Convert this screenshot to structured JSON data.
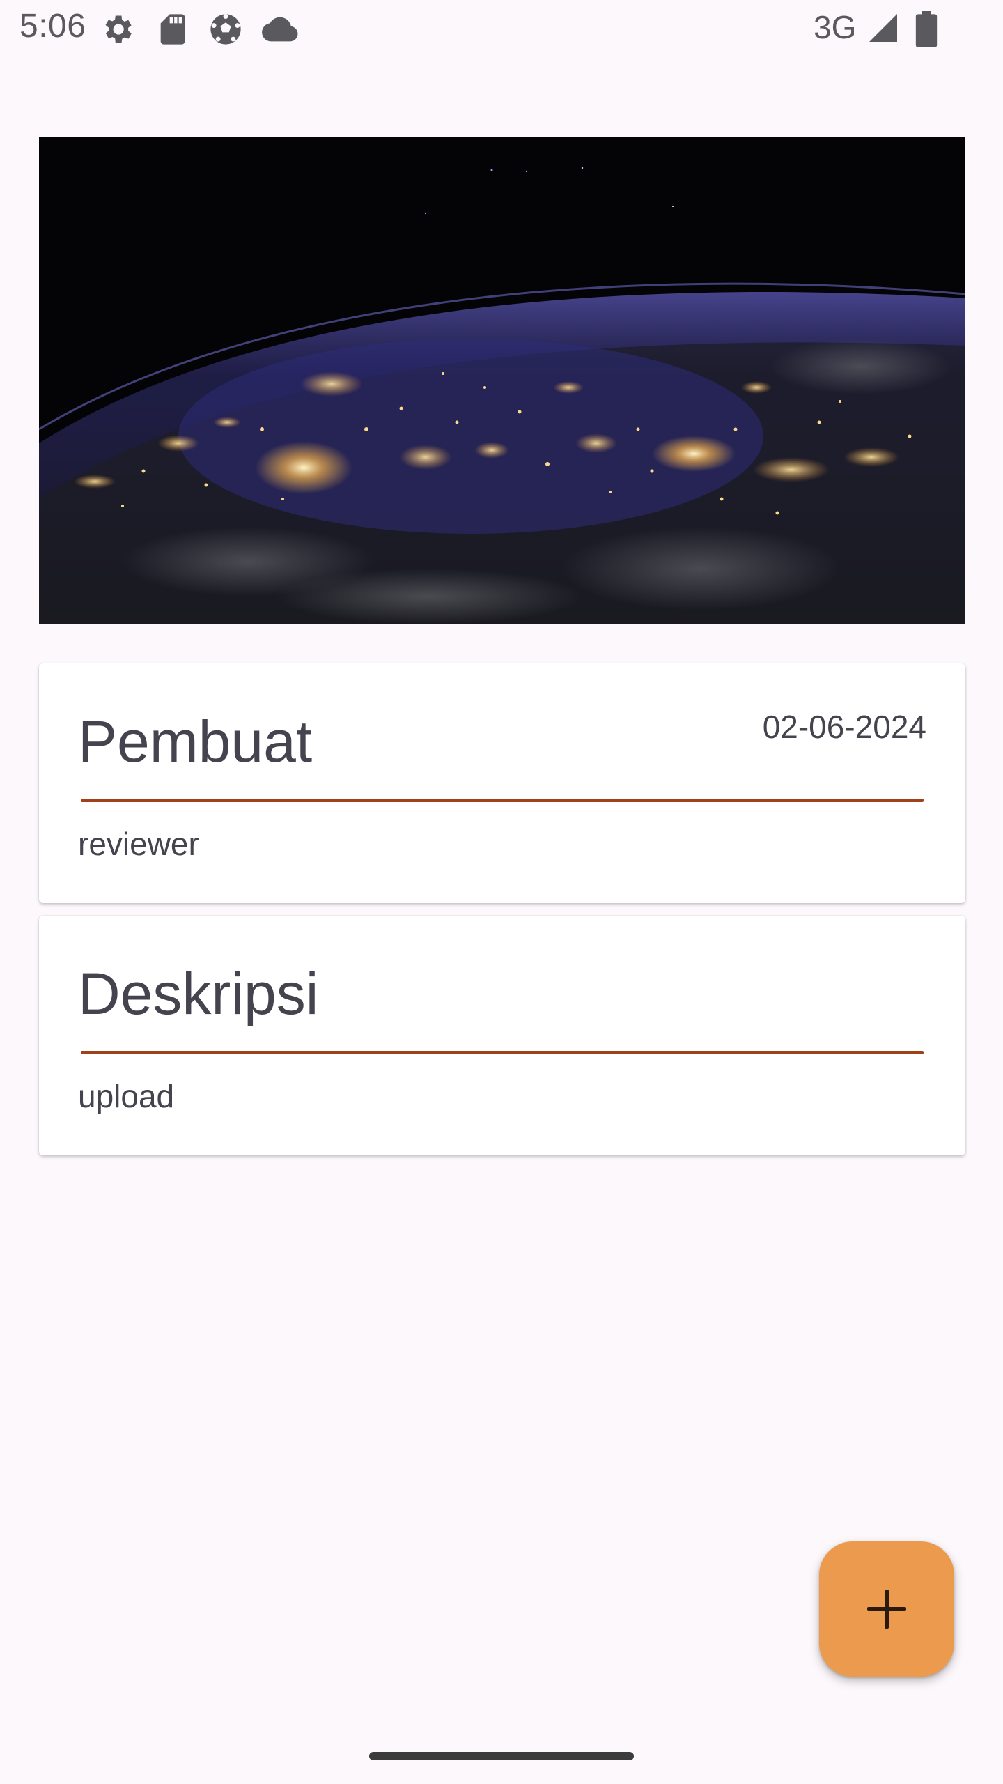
{
  "status_bar": {
    "time": "5:06",
    "network": "3G",
    "left_icons": [
      "settings-gear-icon",
      "sd-card-icon",
      "soccer-ball-icon",
      "cloud-icon"
    ],
    "right_icons": [
      "signal-icon",
      "battery-icon"
    ]
  },
  "hero_image": {
    "subject": "earth-at-night-from-space"
  },
  "creator_card": {
    "title": "Pembuat",
    "date": "02-06-2024",
    "value": "reviewer"
  },
  "description_card": {
    "title": "Deskripsi",
    "value": "upload"
  },
  "fab": {
    "icon": "plus-icon"
  },
  "colors": {
    "background": "#fdf8fb",
    "divider": "#a0411a",
    "fab": "#ec9a4d",
    "text": "#44434e"
  }
}
